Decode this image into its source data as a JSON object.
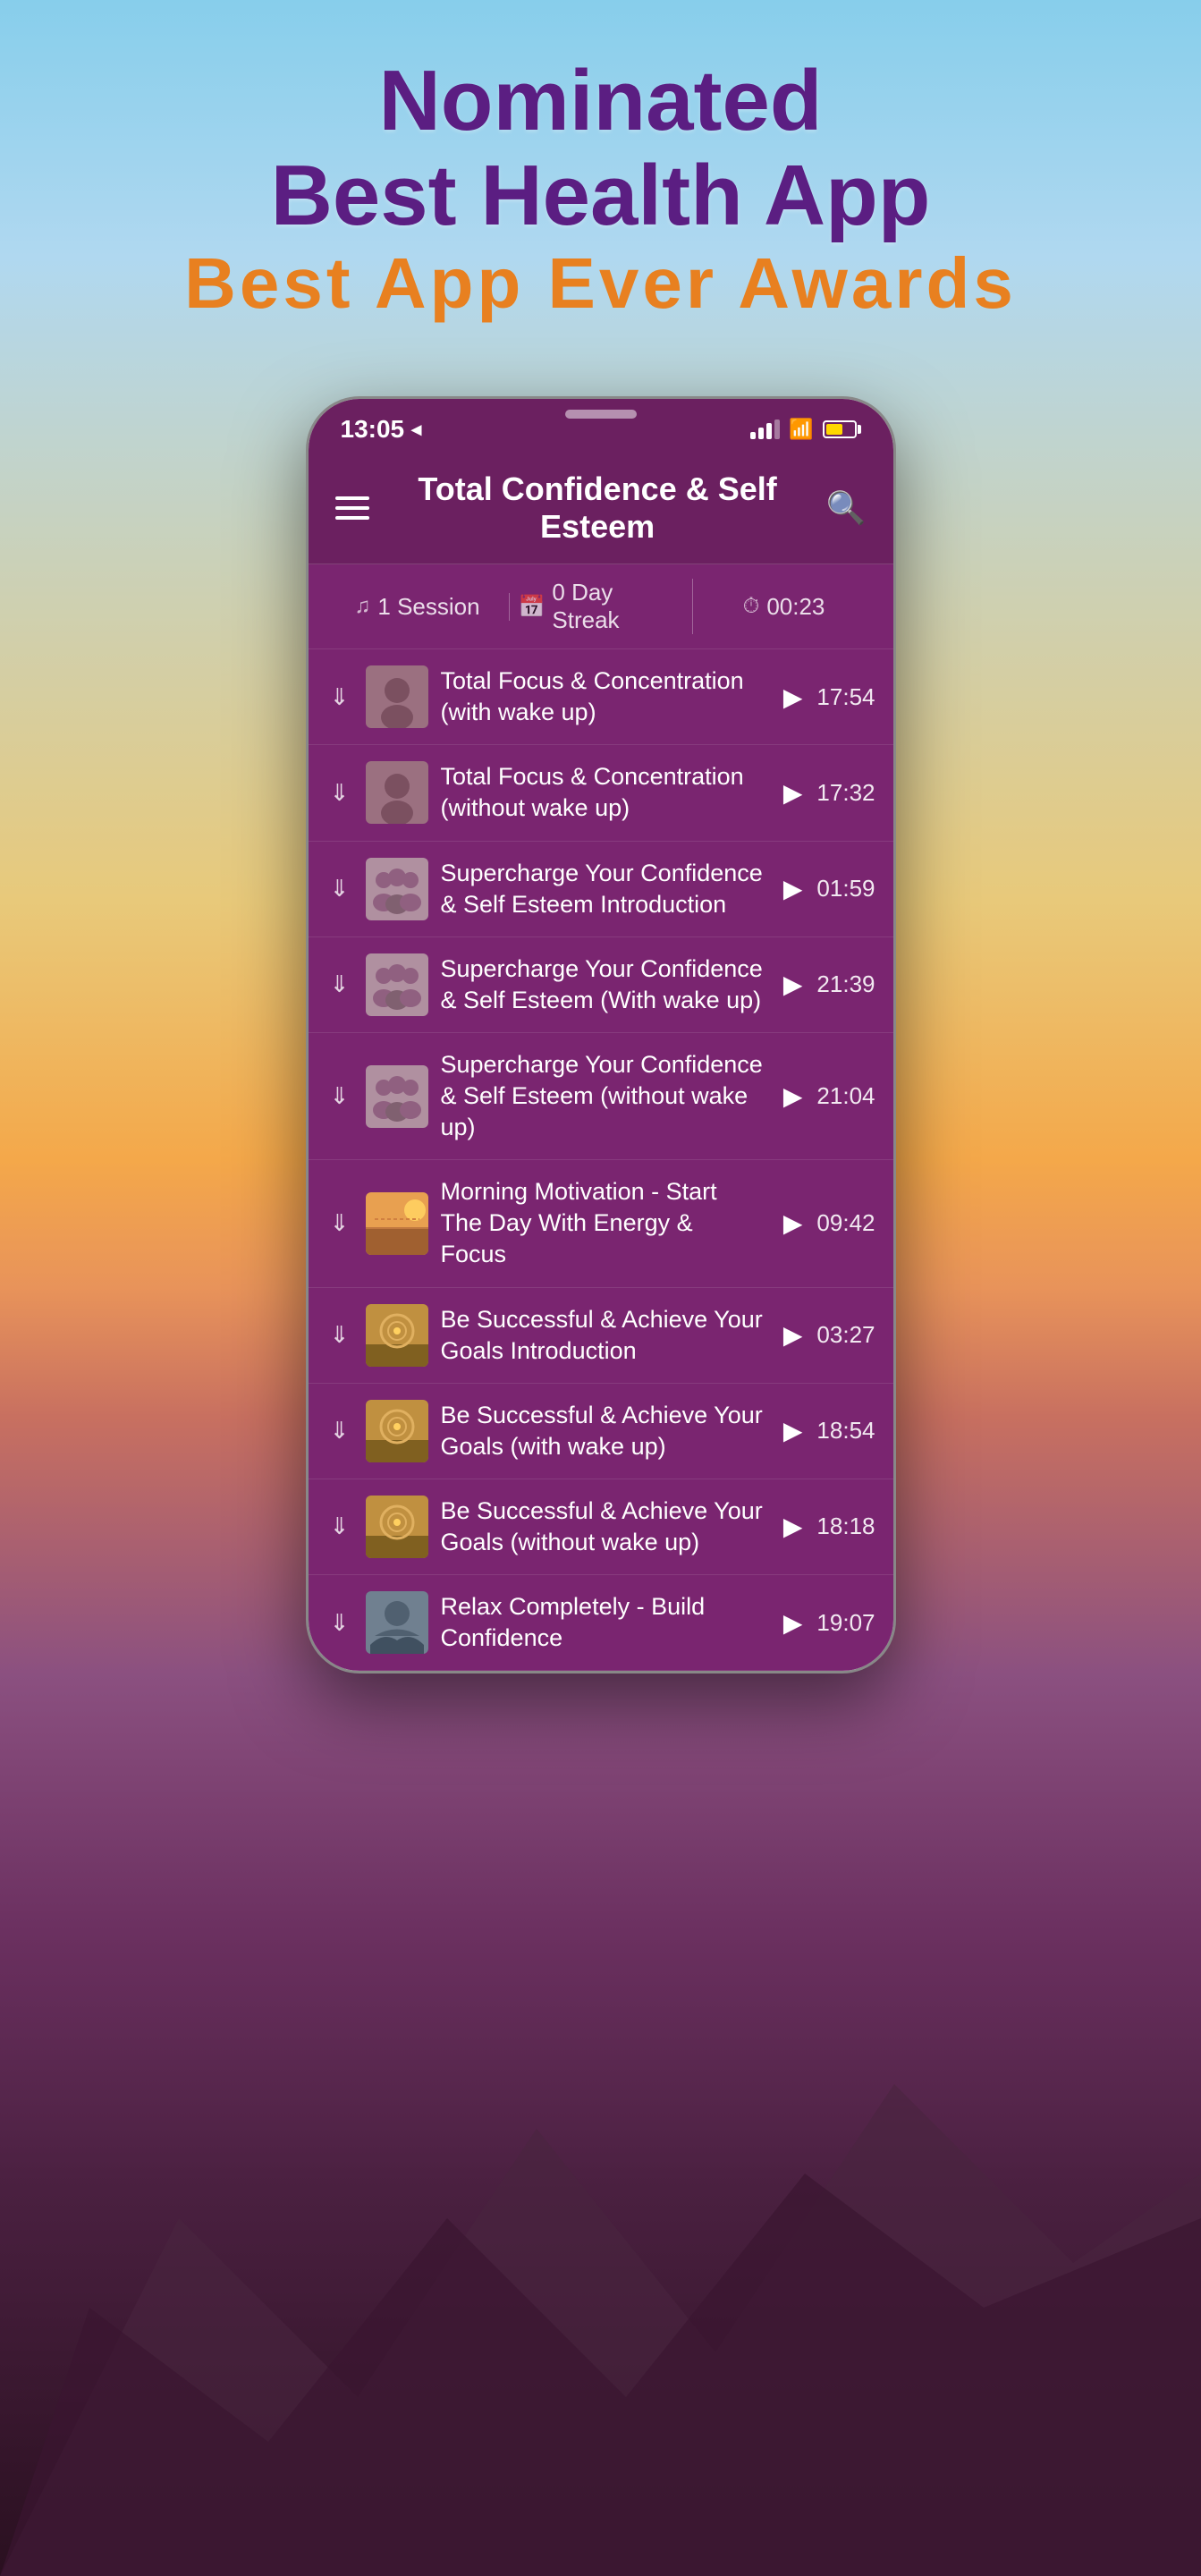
{
  "background": {
    "colors": [
      "#87CEEB",
      "#E8C97A",
      "#C87060",
      "#8B5080",
      "#4A2040"
    ]
  },
  "award": {
    "line1": "Nominated",
    "line2": "Best Health App",
    "line3": "Best App Ever Awards"
  },
  "phone": {
    "statusBar": {
      "time": "13:05",
      "locationIcon": "◂",
      "batteryPercent": 60
    },
    "appHeader": {
      "title": "Total Confidence & Self Esteem",
      "menuLabel": "menu",
      "searchLabel": "search"
    },
    "statsBar": {
      "sessions": "1 Session",
      "streakDays": "0 Day Streak",
      "time": "00:23"
    },
    "tracks": [
      {
        "id": 1,
        "name": "Total Focus & Concentration (with wake up)",
        "duration": "17:54",
        "thumbType": "focus"
      },
      {
        "id": 2,
        "name": "Total Focus & Concentration (without wake up)",
        "duration": "17:32",
        "thumbType": "focus"
      },
      {
        "id": 3,
        "name": "Supercharge Your Confidence & Self Esteem Introduction",
        "duration": "01:59",
        "thumbType": "group"
      },
      {
        "id": 4,
        "name": "Supercharge Your Confidence & Self Esteem (With wake up)",
        "duration": "21:39",
        "thumbType": "group"
      },
      {
        "id": 5,
        "name": "Supercharge Your Confidence & Self Esteem (without wake up)",
        "duration": "21:04",
        "thumbType": "group"
      },
      {
        "id": 6,
        "name": "Morning Motivation - Start The Day With Energy & Focus",
        "duration": "09:42",
        "thumbType": "morning"
      },
      {
        "id": 7,
        "name": "Be Successful & Achieve Your Goals Introduction",
        "duration": "03:27",
        "thumbType": "goals"
      },
      {
        "id": 8,
        "name": "Be Successful & Achieve Your Goals (with wake up)",
        "duration": "18:54",
        "thumbType": "goals"
      },
      {
        "id": 9,
        "name": "Be Successful & Achieve Your Goals (without wake up)",
        "duration": "18:18",
        "thumbType": "goals"
      },
      {
        "id": 10,
        "name": "Relax Completely - Build Confidence",
        "duration": "19:07",
        "thumbType": "relax"
      }
    ]
  }
}
